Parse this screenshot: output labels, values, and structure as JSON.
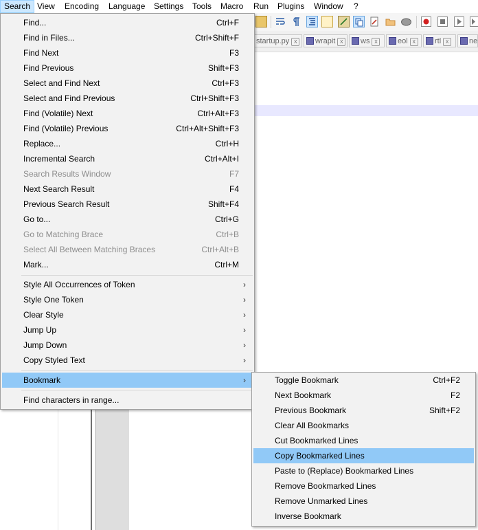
{
  "menubar": [
    "Search",
    "View",
    "Encoding",
    "Language",
    "Settings",
    "Tools",
    "Macro",
    "Run",
    "Plugins",
    "Window",
    "?"
  ],
  "tabs": [
    "startup.py",
    "wrapit",
    "ws",
    "eol",
    "rtl",
    "new"
  ],
  "search_menu": {
    "group1": [
      {
        "label": "Find...",
        "shortcut": "Ctrl+F",
        "disabled": false
      },
      {
        "label": "Find in Files...",
        "shortcut": "Ctrl+Shift+F",
        "disabled": false
      },
      {
        "label": "Find Next",
        "shortcut": "F3",
        "disabled": false
      },
      {
        "label": "Find Previous",
        "shortcut": "Shift+F3",
        "disabled": false
      },
      {
        "label": "Select and Find Next",
        "shortcut": "Ctrl+F3",
        "disabled": false
      },
      {
        "label": "Select and Find Previous",
        "shortcut": "Ctrl+Shift+F3",
        "disabled": false
      },
      {
        "label": "Find (Volatile) Next",
        "shortcut": "Ctrl+Alt+F3",
        "disabled": false
      },
      {
        "label": "Find (Volatile) Previous",
        "shortcut": "Ctrl+Alt+Shift+F3",
        "disabled": false
      },
      {
        "label": "Replace...",
        "shortcut": "Ctrl+H",
        "disabled": false
      },
      {
        "label": "Incremental Search",
        "shortcut": "Ctrl+Alt+I",
        "disabled": false
      },
      {
        "label": "Search Results Window",
        "shortcut": "F7",
        "disabled": true
      },
      {
        "label": "Next Search Result",
        "shortcut": "F4",
        "disabled": false
      },
      {
        "label": "Previous Search Result",
        "shortcut": "Shift+F4",
        "disabled": false
      },
      {
        "label": "Go to...",
        "shortcut": "Ctrl+G",
        "disabled": false
      },
      {
        "label": "Go to Matching Brace",
        "shortcut": "Ctrl+B",
        "disabled": true
      },
      {
        "label": "Select All Between Matching Braces",
        "shortcut": "Ctrl+Alt+B",
        "disabled": true
      },
      {
        "label": "Mark...",
        "shortcut": "Ctrl+M",
        "disabled": false
      }
    ],
    "group2": [
      {
        "label": "Style All Occurrences of Token"
      },
      {
        "label": "Style One Token"
      },
      {
        "label": "Clear Style"
      },
      {
        "label": "Jump Up"
      },
      {
        "label": "Jump Down"
      },
      {
        "label": "Copy Styled Text"
      }
    ],
    "bookmark": "Bookmark",
    "find_chars": "Find characters in range..."
  },
  "bookmark_menu": [
    {
      "label": "Toggle Bookmark",
      "shortcut": "Ctrl+F2"
    },
    {
      "label": "Next Bookmark",
      "shortcut": "F2"
    },
    {
      "label": "Previous Bookmark",
      "shortcut": "Shift+F2"
    },
    {
      "label": "Clear All Bookmarks",
      "shortcut": ""
    },
    {
      "label": "Cut Bookmarked Lines",
      "shortcut": ""
    },
    {
      "label": "Copy Bookmarked Lines",
      "shortcut": "",
      "highlighted": true
    },
    {
      "label": "Paste to (Replace) Bookmarked Lines",
      "shortcut": ""
    },
    {
      "label": "Remove Bookmarked Lines",
      "shortcut": ""
    },
    {
      "label": "Remove Unmarked Lines",
      "shortcut": ""
    },
    {
      "label": "Inverse Bookmark",
      "shortcut": ""
    }
  ],
  "submenu_arrow": "›",
  "tab_close": "x",
  "colors": {
    "highlight": "#91c9f7",
    "menubar_active": "#cce8ff",
    "disabled_text": "#8d8d8d"
  }
}
